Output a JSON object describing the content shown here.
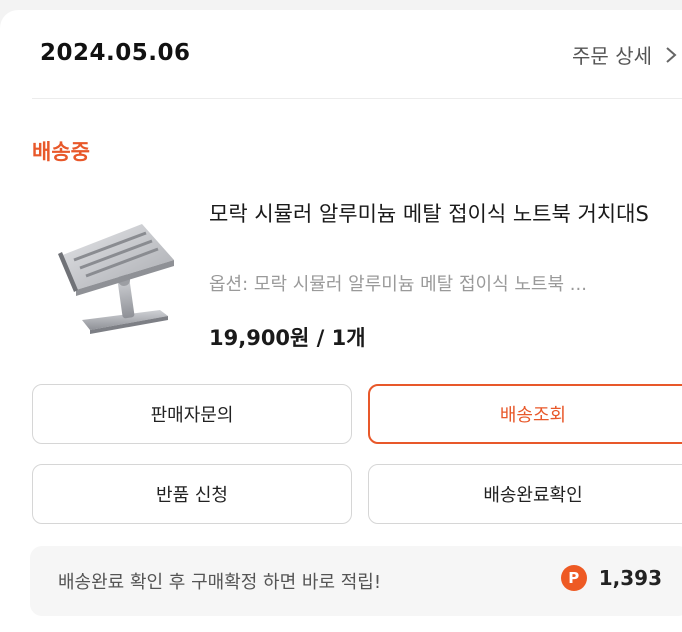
{
  "order": {
    "date": "2024.05.06",
    "detail_label": "주문 상세",
    "status": "배송중"
  },
  "product": {
    "image_icon": "laptop-stand-icon",
    "title": "모락 시뮬러 알루미늄 메탈 접이식 노트북 거치대S",
    "option": "옵션: 모락 시뮬러 알루미늄 메탈 접이식 노트북 ...",
    "price": "19,900원 / 1개"
  },
  "actions": {
    "seller_inquiry": "판매자문의",
    "track_delivery": "배송조회",
    "return_request": "반품 신청",
    "confirm_delivery": "배송완료확인"
  },
  "rewards": {
    "message": "배송완료 확인 후 구매확정 하면 바로 적립!",
    "icon_letter": "P",
    "points": "1,393"
  },
  "colors": {
    "accent": "#e8582a",
    "point_badge": "#ee5a24"
  }
}
